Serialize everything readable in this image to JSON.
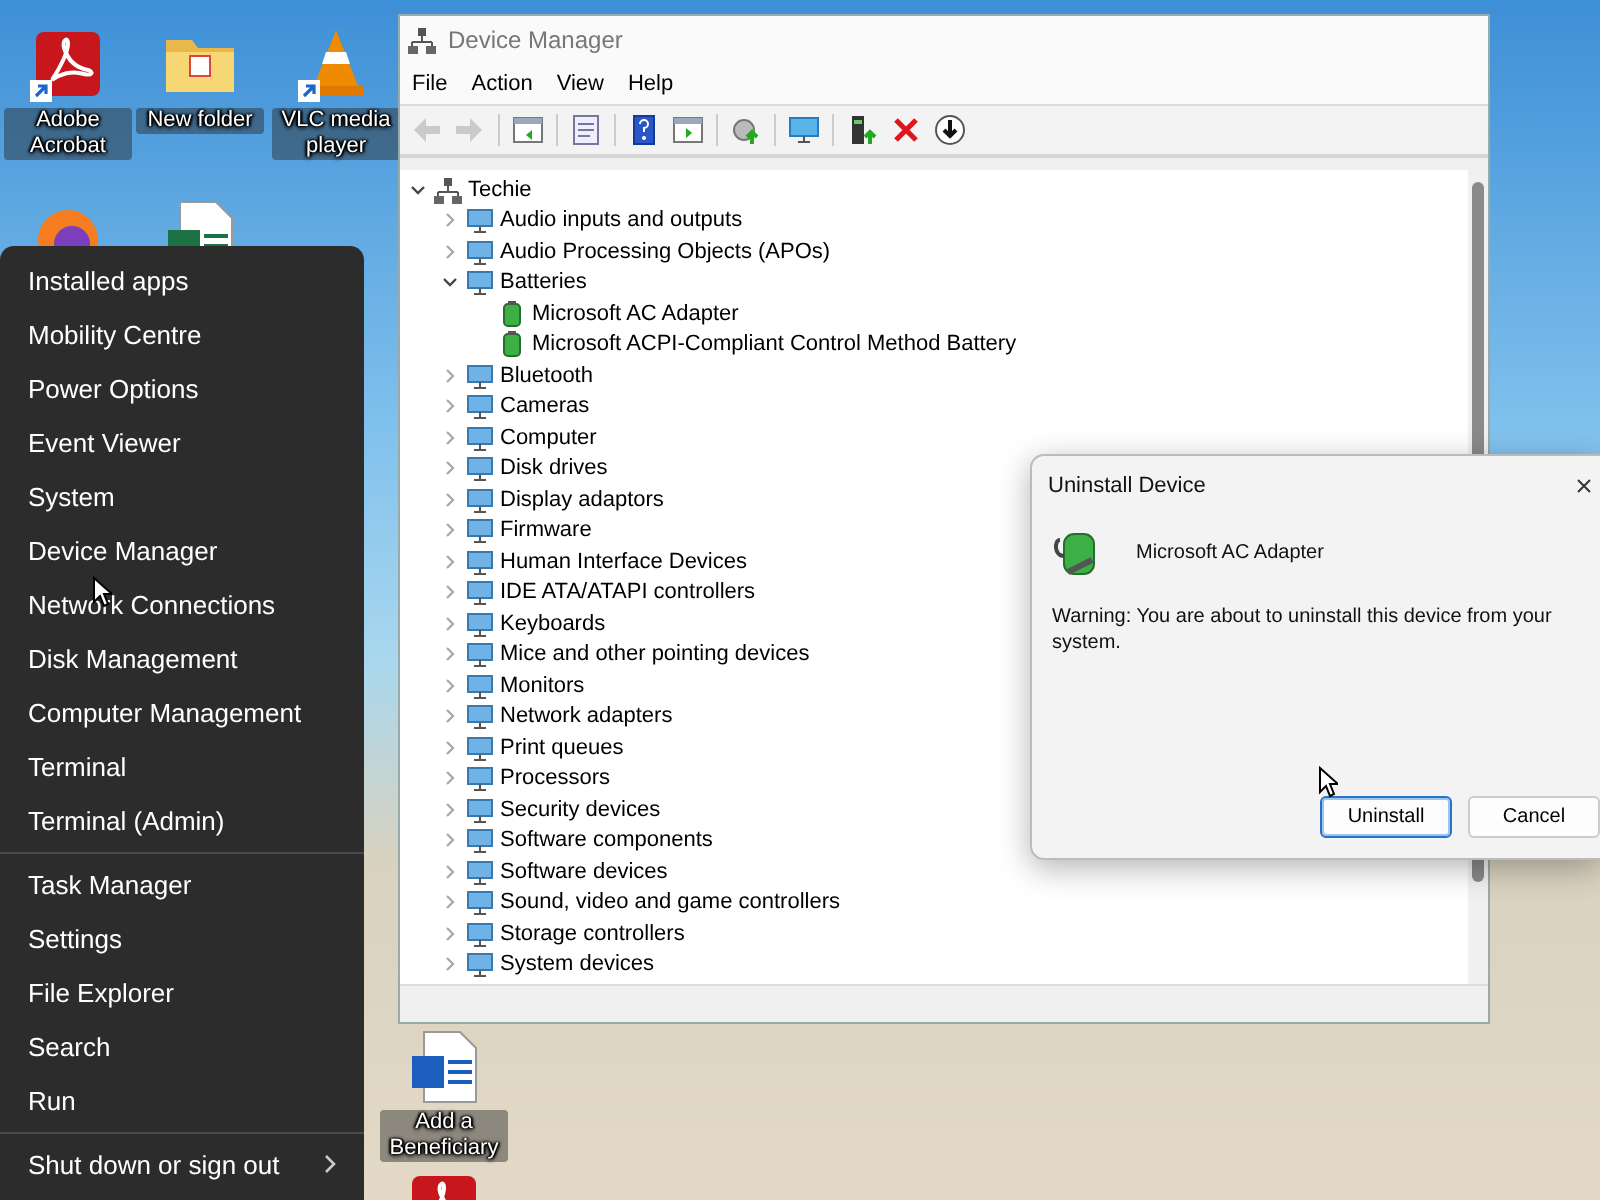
{
  "desktop_icons": [
    {
      "label": "Adobe Acrobat",
      "kind": "pdf",
      "shortcut": true
    },
    {
      "label": "New folder",
      "kind": "folder",
      "shortcut": false
    },
    {
      "label": "VLC media player",
      "kind": "vlc",
      "shortcut": true
    },
    {
      "kind": "firefox",
      "shortcut": false
    },
    {
      "kind": "excel",
      "shortcut": false
    },
    {
      "label": "Add a Beneficiary",
      "kind": "word",
      "shortcut": false
    },
    {
      "kind": "pdf",
      "shortcut": false
    }
  ],
  "start_menu": {
    "groups": [
      [
        {
          "label": "Installed apps"
        },
        {
          "label": "Mobility Centre"
        },
        {
          "label": "Power Options"
        },
        {
          "label": "Event Viewer"
        },
        {
          "label": "System"
        },
        {
          "label": "Device Manager"
        },
        {
          "label": "Network Connections"
        },
        {
          "label": "Disk Management"
        },
        {
          "label": "Computer Management"
        },
        {
          "label": "Terminal"
        },
        {
          "label": "Terminal (Admin)"
        }
      ],
      [
        {
          "label": "Task Manager"
        },
        {
          "label": "Settings"
        },
        {
          "label": "File Explorer"
        },
        {
          "label": "Search"
        },
        {
          "label": "Run"
        }
      ],
      [
        {
          "label": "Shut down or sign out",
          "submenu": true
        }
      ]
    ]
  },
  "device_manager": {
    "title": "Device Manager",
    "menu": [
      "File",
      "Action",
      "View",
      "Help"
    ],
    "toolbar": [
      [
        {
          "kind": "back",
          "disabled": true
        },
        {
          "kind": "forward",
          "disabled": true
        }
      ],
      [
        {
          "kind": "console",
          "disabled": false
        }
      ],
      [
        {
          "kind": "properties",
          "disabled": false
        }
      ],
      [
        {
          "kind": "help",
          "disabled": false
        },
        {
          "kind": "run",
          "disabled": false
        }
      ],
      [
        {
          "kind": "update",
          "disabled": false
        }
      ],
      [
        {
          "kind": "monitor",
          "disabled": false
        }
      ],
      [
        {
          "kind": "enable",
          "disabled": false
        },
        {
          "kind": "uninstall",
          "disabled": false
        },
        {
          "kind": "download",
          "disabled": false
        }
      ]
    ],
    "tree": {
      "label": "Techie",
      "expanded": true,
      "children": [
        {
          "label": "Audio inputs and outputs",
          "expanded": false
        },
        {
          "label": "Audio Processing Objects (APOs)",
          "expanded": false
        },
        {
          "label": "Batteries",
          "expanded": true,
          "children": [
            {
              "label": "Microsoft AC Adapter"
            },
            {
              "label": "Microsoft ACPI-Compliant Control Method Battery"
            }
          ]
        },
        {
          "label": "Bluetooth",
          "expanded": false
        },
        {
          "label": "Cameras",
          "expanded": false
        },
        {
          "label": "Computer",
          "expanded": false
        },
        {
          "label": "Disk drives",
          "expanded": false
        },
        {
          "label": "Display adaptors",
          "expanded": false
        },
        {
          "label": "Firmware",
          "expanded": false
        },
        {
          "label": "Human Interface Devices",
          "expanded": false
        },
        {
          "label": "IDE ATA/ATAPI controllers",
          "expanded": false
        },
        {
          "label": "Keyboards",
          "expanded": false
        },
        {
          "label": "Mice and other pointing devices",
          "expanded": false
        },
        {
          "label": "Monitors",
          "expanded": false
        },
        {
          "label": "Network adapters",
          "expanded": false
        },
        {
          "label": "Print queues",
          "expanded": false
        },
        {
          "label": "Processors",
          "expanded": false
        },
        {
          "label": "Security devices",
          "expanded": false
        },
        {
          "label": "Software components",
          "expanded": false
        },
        {
          "label": "Software devices",
          "expanded": false
        },
        {
          "label": "Sound, video and game controllers",
          "expanded": false
        },
        {
          "label": "Storage controllers",
          "expanded": false
        },
        {
          "label": "System devices",
          "expanded": false
        }
      ]
    }
  },
  "dialog": {
    "title": "Uninstall Device",
    "device": "Microsoft AC Adapter",
    "warning": "Warning: You are about to uninstall this device from your system.",
    "buttons": [
      {
        "label": "Uninstall",
        "selected": true
      },
      {
        "label": "Cancel",
        "selected": false
      }
    ]
  }
}
